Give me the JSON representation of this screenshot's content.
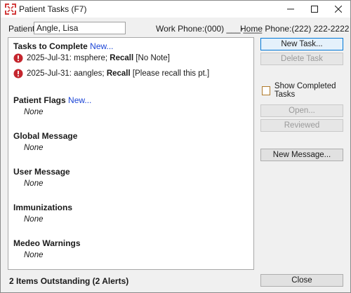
{
  "window": {
    "title": "Patient Tasks (F7)",
    "controls": {
      "minimize_icon": "minimize-icon",
      "maximize_icon": "maximize-icon",
      "close_icon": "close-icon"
    }
  },
  "header": {
    "patient_label": "Patient:",
    "patient_value": "Angle, Lisa",
    "work_phone": "Work Phone:(000) ___-____",
    "home_phone": "Home Phone:(222) 222-2222"
  },
  "sections": {
    "tasks": {
      "title": "Tasks to Complete",
      "new_link": "New...",
      "items": [
        {
          "prefix": "2025-Jul-31: msphere; ",
          "type": "Recall",
          "note": " [No Note]"
        },
        {
          "prefix": "2025-Jul-31: aangles; ",
          "type": "Recall",
          "note": " [Please recall this pt.]"
        }
      ]
    },
    "patient_flags": {
      "title": "Patient Flags",
      "new_link": "New...",
      "value": "None"
    },
    "global_message": {
      "title": "Global Message",
      "value": "None"
    },
    "user_message": {
      "title": "User Message",
      "value": "None"
    },
    "immunizations": {
      "title": "Immunizations",
      "value": "None"
    },
    "medeo_warnings": {
      "title": "Medeo Warnings",
      "value": "None"
    }
  },
  "buttons": {
    "new_task": "New Task...",
    "delete_task": "Delete Task",
    "show_completed": "Show Completed Tasks",
    "open": "Open...",
    "reviewed": "Reviewed",
    "new_message": "New Message...",
    "close": "Close"
  },
  "status": "2 Items Outstanding (2 Alerts)",
  "colors": {
    "alert": "#c4262e",
    "link": "#1a44d6",
    "primary_border": "#0078d7",
    "checkbox_border": "#b07a2a"
  }
}
